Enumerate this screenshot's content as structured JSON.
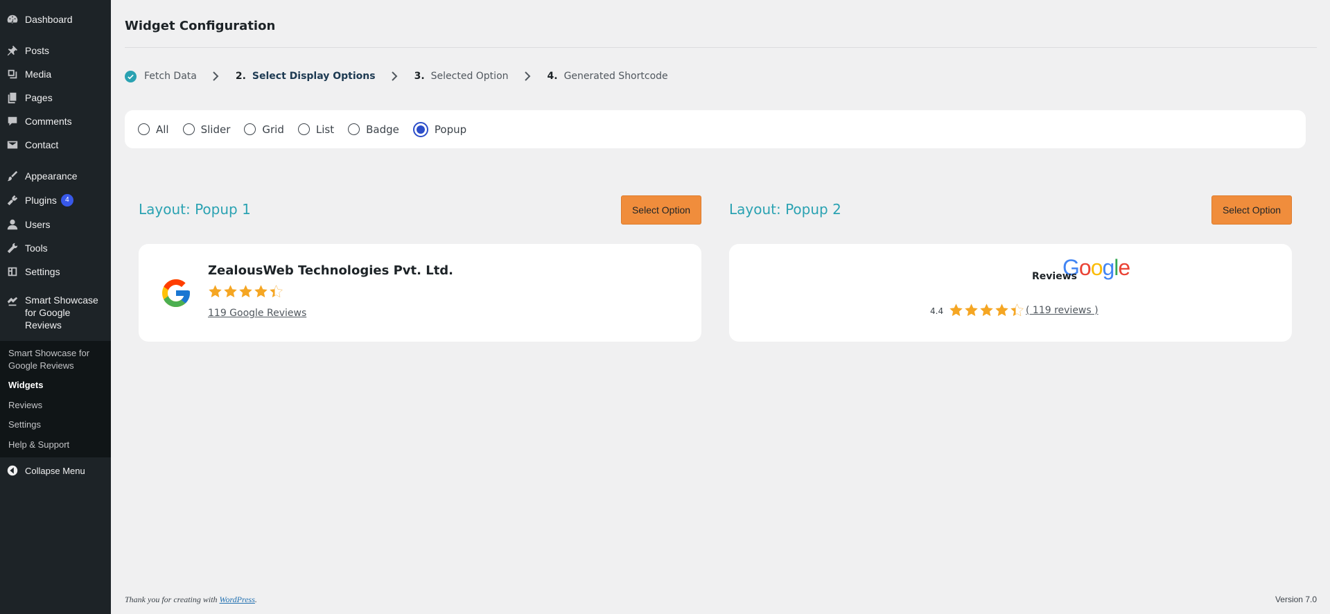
{
  "sidebar": {
    "items": [
      {
        "label": "Dashboard",
        "icon": "dashboard-icon"
      },
      {
        "label": "Posts",
        "icon": "pin-icon"
      },
      {
        "label": "Media",
        "icon": "media-icon"
      },
      {
        "label": "Pages",
        "icon": "pages-icon"
      },
      {
        "label": "Comments",
        "icon": "comment-icon"
      },
      {
        "label": "Contact",
        "icon": "envelope-icon"
      },
      {
        "label": "Appearance",
        "icon": "brush-icon"
      },
      {
        "label": "Plugins",
        "icon": "plugin-icon",
        "badge": "4"
      },
      {
        "label": "Users",
        "icon": "user-icon"
      },
      {
        "label": "Tools",
        "icon": "wrench-icon"
      },
      {
        "label": "Settings",
        "icon": "settings-icon"
      }
    ],
    "current": {
      "label": "Smart Showcase for Google Reviews",
      "icon": "showcase-icon"
    },
    "submenu": [
      {
        "label": "Smart Showcase for Google Reviews"
      },
      {
        "label": "Widgets"
      },
      {
        "label": "Reviews"
      },
      {
        "label": "Settings"
      },
      {
        "label": "Help & Support"
      }
    ],
    "collapse": {
      "label": "Collapse Menu",
      "icon": "collapse-icon"
    }
  },
  "page": {
    "title": "Widget Configuration"
  },
  "steps": [
    {
      "num": "",
      "label": "Fetch Data",
      "state": "done"
    },
    {
      "num": "2.",
      "label": "Select Display Options",
      "state": "active"
    },
    {
      "num": "3.",
      "label": "Selected Option",
      "state": "pending"
    },
    {
      "num": "4.",
      "label": "Generated Shortcode",
      "state": "pending"
    }
  ],
  "display_types": {
    "options": [
      "All",
      "Slider",
      "Grid",
      "List",
      "Badge",
      "Popup"
    ],
    "selected": "Popup"
  },
  "layouts": [
    {
      "title": "Layout: Popup 1",
      "button": "Select Option",
      "company": "ZealousWeb Technologies Pvt. Ltd.",
      "rating": 4.4,
      "reviews_text": "119 Google Reviews"
    },
    {
      "title": "Layout: Popup 2",
      "button": "Select Option",
      "brand_word": "Google",
      "reviews_label": "Reviews",
      "rating_text": "4.4",
      "rating": 4.4,
      "reviews_text": "( 119 reviews )"
    }
  ],
  "colors": {
    "accent_teal": "#2aa2b2",
    "button_orange": "#f08d3c",
    "star_gold": "#f5a623",
    "radio_blue": "#2c4ec9"
  },
  "footer": {
    "thanks_prefix": "Thank you for creating with ",
    "thanks_link": "WordPress",
    "thanks_suffix": ".",
    "version": "Version 7.0"
  }
}
